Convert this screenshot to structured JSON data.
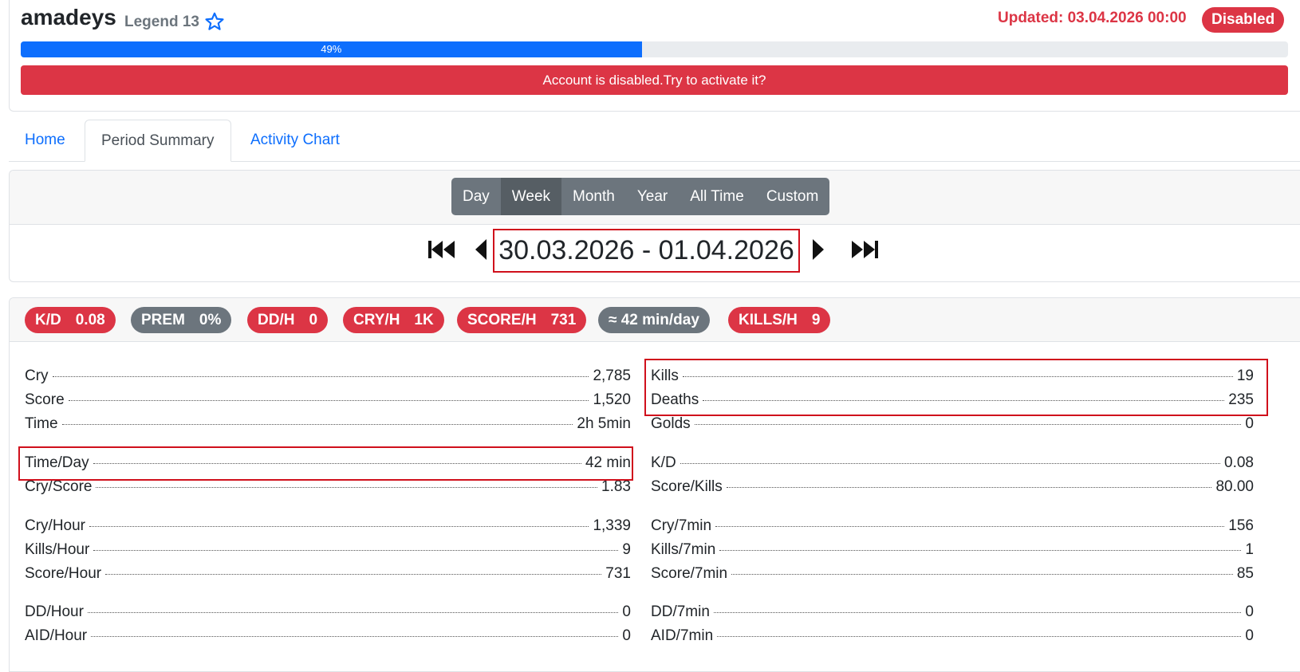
{
  "header": {
    "username": "amadeys",
    "rank": "Legend 13",
    "updated": "Updated: 03.04.2026 00:00",
    "status_badge": "Disabled",
    "progress_percent": 49,
    "progress_label": "49%",
    "alert": "Account is disabled.Try to activate it?"
  },
  "tabs": [
    {
      "label": "Home"
    },
    {
      "label": "Period Summary"
    },
    {
      "label": "Activity Chart"
    }
  ],
  "period": {
    "buttons": [
      "Day",
      "Week",
      "Month",
      "Year",
      "All Time",
      "Custom"
    ],
    "active": "Week",
    "range": "30.03.2026 - 01.04.2026"
  },
  "pills": [
    {
      "label": "K/D",
      "value": "0.08",
      "color": "#dc3545"
    },
    {
      "label": "PREM",
      "value": "0%",
      "color": "#6c757d"
    },
    {
      "label": "DD/H",
      "value": "0",
      "color": "#dc3545"
    },
    {
      "label": "CRY/H",
      "value": "1K",
      "color": "#dc3545"
    },
    {
      "label": "SCORE/H",
      "value": "731",
      "color": "#dc3545"
    },
    {
      "label": "≈ 42 min/day",
      "value": "",
      "color": "#6c757d"
    },
    {
      "label": "KILLS/H",
      "value": "9",
      "color": "#dc3545"
    }
  ],
  "stats_left": [
    {
      "label": "Cry",
      "value": "2,785"
    },
    {
      "label": "Score",
      "value": "1,520"
    },
    {
      "label": "Time",
      "value": "2h 5min"
    },
    {
      "label": "Time/Day",
      "value": "42 min"
    },
    {
      "label": "Cry/Score",
      "value": "1.83"
    },
    {
      "label": "Cry/Hour",
      "value": "1,339"
    },
    {
      "label": "Kills/Hour",
      "value": "9"
    },
    {
      "label": "Score/Hour",
      "value": "731"
    },
    {
      "label": "DD/Hour",
      "value": "0"
    },
    {
      "label": "AID/Hour",
      "value": "0"
    }
  ],
  "stats_right": [
    {
      "label": "Kills",
      "value": "19"
    },
    {
      "label": "Deaths",
      "value": "235"
    },
    {
      "label": "Golds",
      "value": "0"
    },
    {
      "label": "K/D",
      "value": "0.08"
    },
    {
      "label": "Score/Kills",
      "value": "80.00"
    },
    {
      "label": "Cry/7min",
      "value": "156"
    },
    {
      "label": "Kills/7min",
      "value": "1"
    },
    {
      "label": "Score/7min",
      "value": "85"
    },
    {
      "label": "DD/7min",
      "value": "0"
    },
    {
      "label": "AID/7min",
      "value": "0"
    }
  ],
  "colors": {
    "accent": "#0d6efd",
    "danger": "#dc3545",
    "secondary": "#6c757d",
    "highlight": "#d0101c"
  },
  "icons": [
    "star-outline-icon",
    "skip-first-icon",
    "prev-icon",
    "next-icon",
    "skip-last-icon"
  ]
}
